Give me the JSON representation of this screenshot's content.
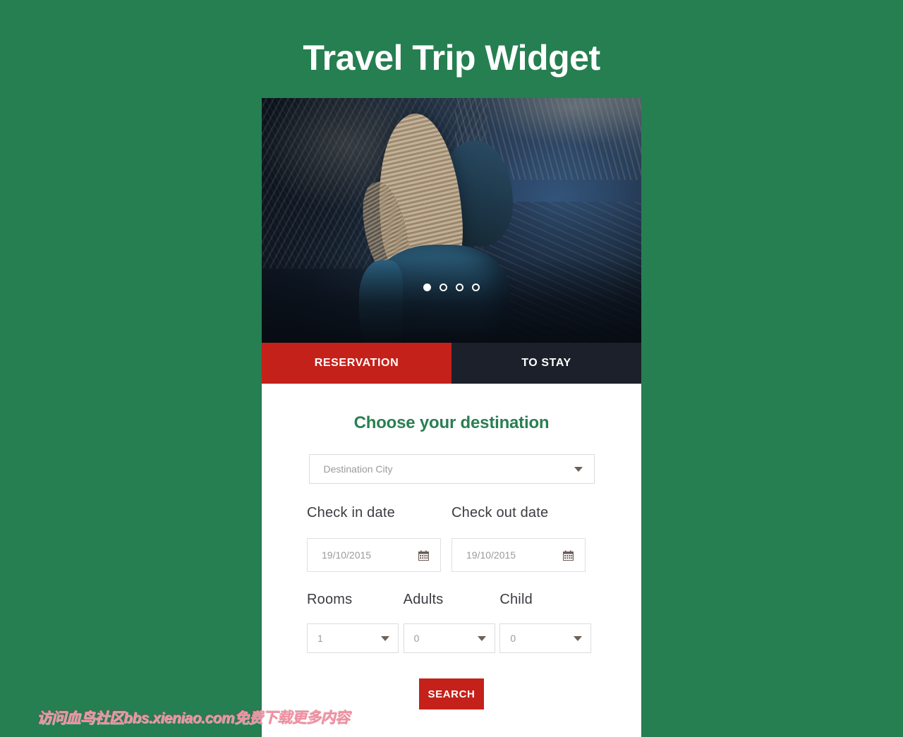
{
  "page": {
    "title": "Travel Trip Widget",
    "background_color": "#257f51"
  },
  "carousel": {
    "slide_count": 4,
    "active_index": 0,
    "image_description": "Woman with long blonde hair in blue jacket looking over a mountain lake"
  },
  "tabs": [
    {
      "label": "RESERVATION",
      "active": true,
      "color": "#c4211a"
    },
    {
      "label": "TO STAY",
      "active": false,
      "color": "#1b202a"
    }
  ],
  "form": {
    "heading": "Choose your destination",
    "heading_color": "#2a7f52",
    "destination": {
      "label": "Destination City",
      "value": "Destination City",
      "icon": "chevron-down-icon"
    },
    "check_in": {
      "label": "Check in date",
      "value": "19/10/2015",
      "icon": "calendar-icon"
    },
    "check_out": {
      "label": "Check out date",
      "value": "19/10/2015",
      "icon": "calendar-icon"
    },
    "rooms": {
      "label": "Rooms",
      "value": "1"
    },
    "adults": {
      "label": "Adults",
      "value": "0"
    },
    "child": {
      "label": "Child",
      "value": "0"
    },
    "search_button": {
      "label": "SEARCH",
      "color": "#c4211a"
    }
  },
  "watermark": {
    "text": "访问血鸟社区bbs.xieniao.com免费下载更多内容",
    "color": "#ef8fa0"
  }
}
